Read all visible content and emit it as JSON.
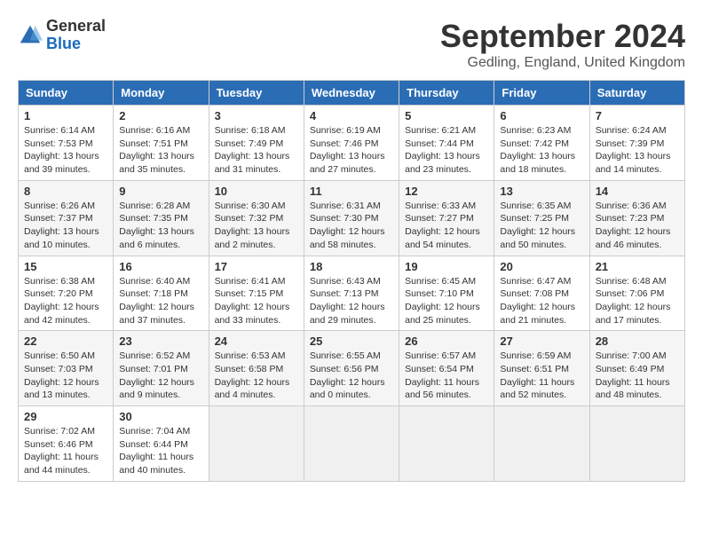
{
  "logo": {
    "general": "General",
    "blue": "Blue"
  },
  "header": {
    "title": "September 2024",
    "subtitle": "Gedling, England, United Kingdom"
  },
  "days_of_week": [
    "Sunday",
    "Monday",
    "Tuesday",
    "Wednesday",
    "Thursday",
    "Friday",
    "Saturday"
  ],
  "weeks": [
    [
      {
        "day": "1",
        "sunrise": "6:14 AM",
        "sunset": "7:53 PM",
        "daylight": "13 hours and 39 minutes."
      },
      {
        "day": "2",
        "sunrise": "6:16 AM",
        "sunset": "7:51 PM",
        "daylight": "13 hours and 35 minutes."
      },
      {
        "day": "3",
        "sunrise": "6:18 AM",
        "sunset": "7:49 PM",
        "daylight": "13 hours and 31 minutes."
      },
      {
        "day": "4",
        "sunrise": "6:19 AM",
        "sunset": "7:46 PM",
        "daylight": "13 hours and 27 minutes."
      },
      {
        "day": "5",
        "sunrise": "6:21 AM",
        "sunset": "7:44 PM",
        "daylight": "13 hours and 23 minutes."
      },
      {
        "day": "6",
        "sunrise": "6:23 AM",
        "sunset": "7:42 PM",
        "daylight": "13 hours and 18 minutes."
      },
      {
        "day": "7",
        "sunrise": "6:24 AM",
        "sunset": "7:39 PM",
        "daylight": "13 hours and 14 minutes."
      }
    ],
    [
      {
        "day": "8",
        "sunrise": "6:26 AM",
        "sunset": "7:37 PM",
        "daylight": "13 hours and 10 minutes."
      },
      {
        "day": "9",
        "sunrise": "6:28 AM",
        "sunset": "7:35 PM",
        "daylight": "13 hours and 6 minutes."
      },
      {
        "day": "10",
        "sunrise": "6:30 AM",
        "sunset": "7:32 PM",
        "daylight": "13 hours and 2 minutes."
      },
      {
        "day": "11",
        "sunrise": "6:31 AM",
        "sunset": "7:30 PM",
        "daylight": "12 hours and 58 minutes."
      },
      {
        "day": "12",
        "sunrise": "6:33 AM",
        "sunset": "7:27 PM",
        "daylight": "12 hours and 54 minutes."
      },
      {
        "day": "13",
        "sunrise": "6:35 AM",
        "sunset": "7:25 PM",
        "daylight": "12 hours and 50 minutes."
      },
      {
        "day": "14",
        "sunrise": "6:36 AM",
        "sunset": "7:23 PM",
        "daylight": "12 hours and 46 minutes."
      }
    ],
    [
      {
        "day": "15",
        "sunrise": "6:38 AM",
        "sunset": "7:20 PM",
        "daylight": "12 hours and 42 minutes."
      },
      {
        "day": "16",
        "sunrise": "6:40 AM",
        "sunset": "7:18 PM",
        "daylight": "12 hours and 37 minutes."
      },
      {
        "day": "17",
        "sunrise": "6:41 AM",
        "sunset": "7:15 PM",
        "daylight": "12 hours and 33 minutes."
      },
      {
        "day": "18",
        "sunrise": "6:43 AM",
        "sunset": "7:13 PM",
        "daylight": "12 hours and 29 minutes."
      },
      {
        "day": "19",
        "sunrise": "6:45 AM",
        "sunset": "7:10 PM",
        "daylight": "12 hours and 25 minutes."
      },
      {
        "day": "20",
        "sunrise": "6:47 AM",
        "sunset": "7:08 PM",
        "daylight": "12 hours and 21 minutes."
      },
      {
        "day": "21",
        "sunrise": "6:48 AM",
        "sunset": "7:06 PM",
        "daylight": "12 hours and 17 minutes."
      }
    ],
    [
      {
        "day": "22",
        "sunrise": "6:50 AM",
        "sunset": "7:03 PM",
        "daylight": "12 hours and 13 minutes."
      },
      {
        "day": "23",
        "sunrise": "6:52 AM",
        "sunset": "7:01 PM",
        "daylight": "12 hours and 9 minutes."
      },
      {
        "day": "24",
        "sunrise": "6:53 AM",
        "sunset": "6:58 PM",
        "daylight": "12 hours and 4 minutes."
      },
      {
        "day": "25",
        "sunrise": "6:55 AM",
        "sunset": "6:56 PM",
        "daylight": "12 hours and 0 minutes."
      },
      {
        "day": "26",
        "sunrise": "6:57 AM",
        "sunset": "6:54 PM",
        "daylight": "11 hours and 56 minutes."
      },
      {
        "day": "27",
        "sunrise": "6:59 AM",
        "sunset": "6:51 PM",
        "daylight": "11 hours and 52 minutes."
      },
      {
        "day": "28",
        "sunrise": "7:00 AM",
        "sunset": "6:49 PM",
        "daylight": "11 hours and 48 minutes."
      }
    ],
    [
      {
        "day": "29",
        "sunrise": "7:02 AM",
        "sunset": "6:46 PM",
        "daylight": "11 hours and 44 minutes."
      },
      {
        "day": "30",
        "sunrise": "7:04 AM",
        "sunset": "6:44 PM",
        "daylight": "11 hours and 40 minutes."
      },
      null,
      null,
      null,
      null,
      null
    ]
  ]
}
